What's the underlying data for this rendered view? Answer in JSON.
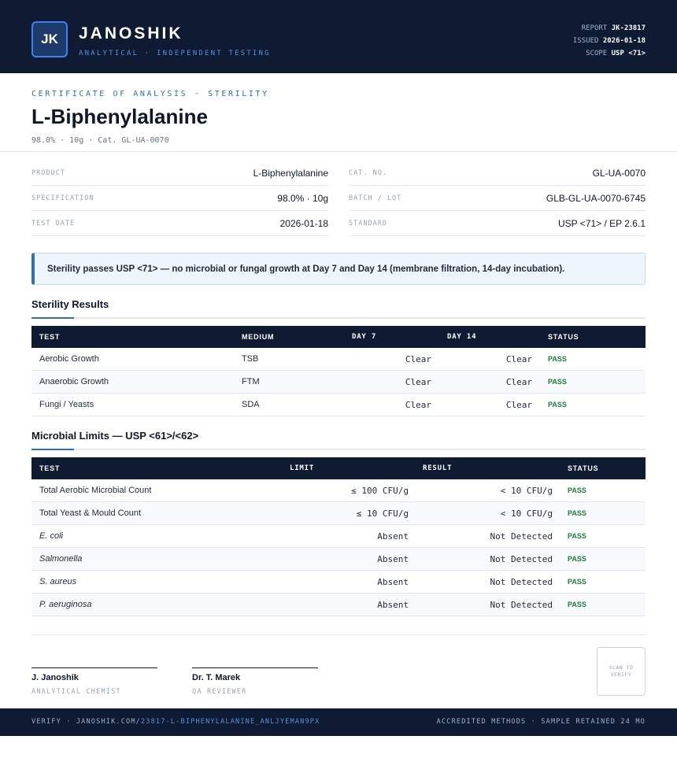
{
  "header": {
    "logo": "JK",
    "brand": "JANOSHIK",
    "tagline": "ANALYTICAL · INDEPENDENT TESTING",
    "report_label": "REPORT",
    "report_value": "JK-23817",
    "issued_label": "ISSUED",
    "issued_value": "2026-01-18",
    "scope_label": "SCOPE",
    "scope_value": "USP <71>"
  },
  "title_block": {
    "eyebrow": "CERTIFICATE OF ANALYSIS · STERILITY",
    "title": "L-Biphenylalanine",
    "subtitle": "98.0% · 10g  ·  Cat. GL-UA-0070"
  },
  "info": {
    "left": [
      {
        "label": "PRODUCT",
        "value": "L-Biphenylalanine"
      },
      {
        "label": "SPECIFICATION",
        "value": "98.0% · 10g"
      },
      {
        "label": "TEST DATE",
        "value": "2026-01-18"
      }
    ],
    "right": [
      {
        "label": "CAT. NO.",
        "value": "GL-UA-0070"
      },
      {
        "label": "BATCH / LOT",
        "value": "GLB-GL-UA-0070-6745"
      },
      {
        "label": "STANDARD",
        "value": "USP <71> / EP 2.6.1"
      }
    ]
  },
  "notice": "Sterility passes USP <71> — no microbial or fungal growth at Day 7 and Day 14 (membrane filtration, 14-day incubation).",
  "sterility": {
    "heading": "Sterility Results",
    "columns": [
      "TEST",
      "MEDIUM",
      "DAY 7",
      "DAY 14",
      "STATUS"
    ],
    "rows": [
      {
        "test": "Aerobic Growth",
        "medium": "TSB",
        "day7": "Clear",
        "day14": "Clear",
        "status": "PASS"
      },
      {
        "test": "Anaerobic Growth",
        "medium": "FTM",
        "day7": "Clear",
        "day14": "Clear",
        "status": "PASS"
      },
      {
        "test": "Fungi / Yeasts",
        "medium": "SDA",
        "day7": "Clear",
        "day14": "Clear",
        "status": "PASS"
      }
    ]
  },
  "microbial": {
    "heading": "Microbial Limits — USP <61>/<62>",
    "columns": [
      "TEST",
      "LIMIT",
      "RESULT",
      "STATUS"
    ],
    "rows": [
      {
        "test": "Total Aerobic Microbial Count",
        "limit": "≤ 100 CFU/g",
        "result": "< 10 CFU/g",
        "status": "PASS"
      },
      {
        "test": "Total Yeast & Mould Count",
        "limit": "≤ 10 CFU/g",
        "result": "< 10 CFU/g",
        "status": "PASS"
      },
      {
        "test": "E. coli",
        "limit": "Absent",
        "result": "Not Detected",
        "status": "PASS"
      },
      {
        "test": "Salmonella",
        "limit": "Absent",
        "result": "Not Detected",
        "status": "PASS"
      },
      {
        "test": "S. aureus",
        "limit": "Absent",
        "result": "Not Detected",
        "status": "PASS"
      },
      {
        "test": "P. aeruginosa",
        "limit": "Absent",
        "result": "Not Detected",
        "status": "PASS"
      }
    ]
  },
  "signatures": [
    {
      "name": "J. Janoshik",
      "role": "ANALYTICAL CHEMIST"
    },
    {
      "name": "Dr. T. Marek",
      "role": "QA REVIEWER"
    }
  ],
  "qr_text": "SCAN TO VERIFY",
  "footer": {
    "verify_prefix": "VERIFY · JANOSHIK.COM/",
    "verify_link": "23817-L-BIPHENYLALANINE_ANLJYEMAN9PX",
    "right": "ACCREDITED METHODS · SAMPLE RETAINED 24 MO"
  },
  "colors": {
    "navy": "#0f1b33",
    "accent": "#2f6fb3",
    "pass": "#1a7f3c"
  }
}
